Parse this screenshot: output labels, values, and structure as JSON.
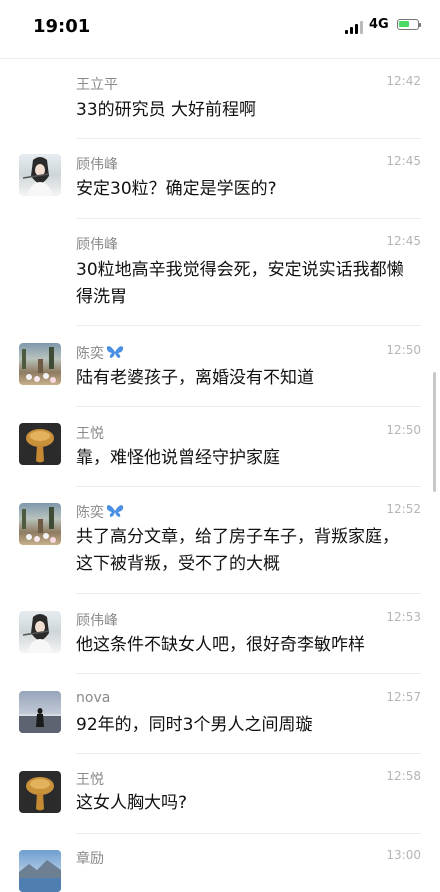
{
  "status": {
    "time": "19:01",
    "network": "4G"
  },
  "comments": [
    {
      "name": "王立平",
      "time": "12:42",
      "text": "33的研究员 大好前程啊",
      "avatar": "none"
    },
    {
      "name": "顾伟峰",
      "time": "12:45",
      "text": "安定30粒？确定是学医的?",
      "avatar": "woman-flute"
    },
    {
      "name": "顾伟峰",
      "time": "12:45",
      "text": "30粒地高辛我觉得会死，安定说实话我都懒得洗胃",
      "avatar": "none"
    },
    {
      "name": "陈奕",
      "time": "12:50",
      "text": "陆有老婆孩子，离婚没有不知道",
      "avatar": "tulips",
      "badge": "butterfly-icon"
    },
    {
      "name": "王悦",
      "time": "12:50",
      "text": "靠，难怪他说曾经守护家庭",
      "avatar": "mushroom"
    },
    {
      "name": "陈奕",
      "time": "12:52",
      "text": "共了高分文章，给了房子车子，背叛家庭，这下被背叛，受不了的大概",
      "avatar": "tulips",
      "badge": "butterfly-icon"
    },
    {
      "name": "顾伟峰",
      "time": "12:53",
      "text": "他这条件不缺女人吧，很好奇李敏咋样",
      "avatar": "woman-flute"
    },
    {
      "name": "nova",
      "time": "12:57",
      "text": "92年的，同时3个男人之间周璇",
      "avatar": "figure-at-sea"
    },
    {
      "name": "王悦",
      "time": "12:58",
      "text": "这女人胸大吗?",
      "avatar": "mushroom"
    },
    {
      "name": "章励",
      "time": "13:00",
      "text": "",
      "avatar": "lake"
    }
  ],
  "colors": {
    "name": "#8a8a8a",
    "time": "#b5b5b5",
    "text": "#111111",
    "divider": "#ececec",
    "butterfly": "#4a90e2"
  }
}
